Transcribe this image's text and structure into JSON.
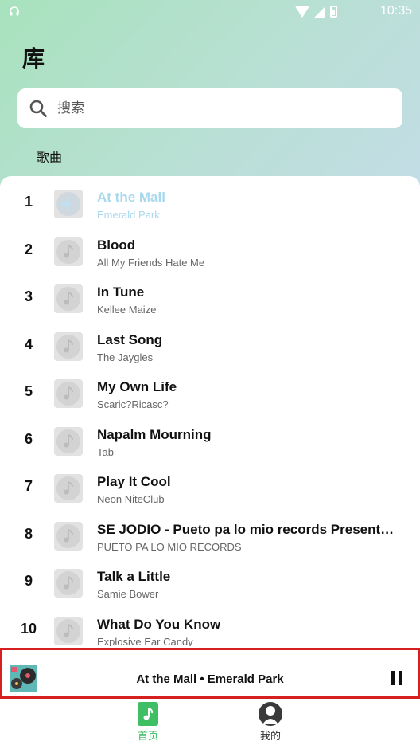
{
  "status_bar": {
    "time": "10:35",
    "left_icon": "headphones-icon"
  },
  "page": {
    "title": "库"
  },
  "search": {
    "placeholder": "搜索",
    "icon": "search-icon"
  },
  "section_tab": {
    "label": "歌曲"
  },
  "songs": [
    {
      "index": "1",
      "title": "At the Mall",
      "artist": "Emerald Park",
      "playing": true
    },
    {
      "index": "2",
      "title": "Blood",
      "artist": "All My Friends Hate Me"
    },
    {
      "index": "3",
      "title": "In Tune",
      "artist": "Kellee Maize"
    },
    {
      "index": "4",
      "title": "Last Song",
      "artist": "The Jaygles"
    },
    {
      "index": "5",
      "title": "My Own Life",
      "artist": "Scaric?Ricasc?"
    },
    {
      "index": "6",
      "title": "Napalm Mourning",
      "artist": "Tab"
    },
    {
      "index": "7",
      "title": "Play It Cool",
      "artist": "Neon NiteClub"
    },
    {
      "index": "8",
      "title": "SE JODIO - Pueto pa lo mio records Presenta -...",
      "artist": "PUETO PA LO MIO RECORDS"
    },
    {
      "index": "9",
      "title": "Talk a Little",
      "artist": "Samie Bower"
    },
    {
      "index": "10",
      "title": "What Do You Know",
      "artist": "Explosive Ear Candy"
    }
  ],
  "mini_player": {
    "now_playing": "At the Mall • Emerald Park",
    "state": "playing"
  },
  "bottom_nav": [
    {
      "label": "首页",
      "icon": "music-note-icon",
      "active": true
    },
    {
      "label": "我的",
      "icon": "profile-icon",
      "active": false
    }
  ],
  "colors": {
    "header_gradient_start": "#a8e2bd",
    "header_gradient_end": "#c3dde6",
    "playing_text": "#a9d8ee",
    "nav_active": "#3fbf64",
    "highlight_border": "#d62020"
  }
}
